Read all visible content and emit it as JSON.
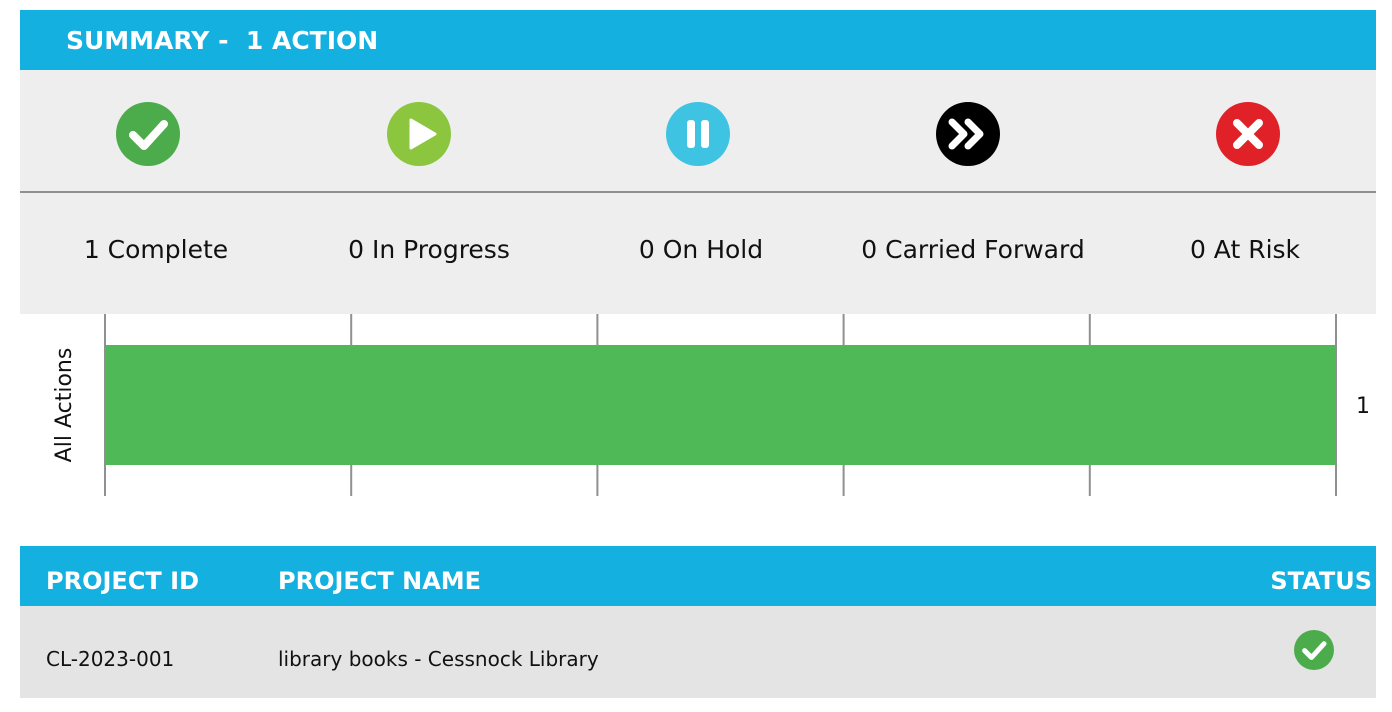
{
  "summary": {
    "title": "SUMMARY -  1 ACTION",
    "statuses": [
      {
        "key": "complete",
        "label": "1 Complete",
        "icon": "check-circle-icon",
        "color": "#4cac4c"
      },
      {
        "key": "in_progress",
        "label": "0 In Progress",
        "icon": "play-circle-icon",
        "color": "#8cc63f"
      },
      {
        "key": "on_hold",
        "label": "0 On Hold",
        "icon": "pause-circle-icon",
        "color": "#3ec4e2"
      },
      {
        "key": "carried_forward",
        "label": "0 Carried Forward",
        "icon": "fast-forward-circle-icon",
        "color": "#000000"
      },
      {
        "key": "at_risk",
        "label": "0 At Risk",
        "icon": "x-circle-icon",
        "color": "#e02127"
      }
    ]
  },
  "chart_data": {
    "type": "bar",
    "orientation": "horizontal",
    "categories": [
      "All Actions"
    ],
    "series": [
      {
        "values": [
          1
        ],
        "color": "#50b957"
      }
    ],
    "value_labels": [
      "1"
    ],
    "ylabel": "All Actions",
    "xlim": [
      0,
      1
    ],
    "grid": true,
    "grid_color": "#909090"
  },
  "table": {
    "headers": {
      "project_id": "PROJECT ID",
      "project_name": "PROJECT NAME",
      "status": "STATUS"
    },
    "rows": [
      {
        "project_id": "CL-2023-001",
        "project_name": "library books - Cessnock Library",
        "status_icon": "check-circle-icon",
        "status_color": "#4cac4c"
      }
    ]
  }
}
